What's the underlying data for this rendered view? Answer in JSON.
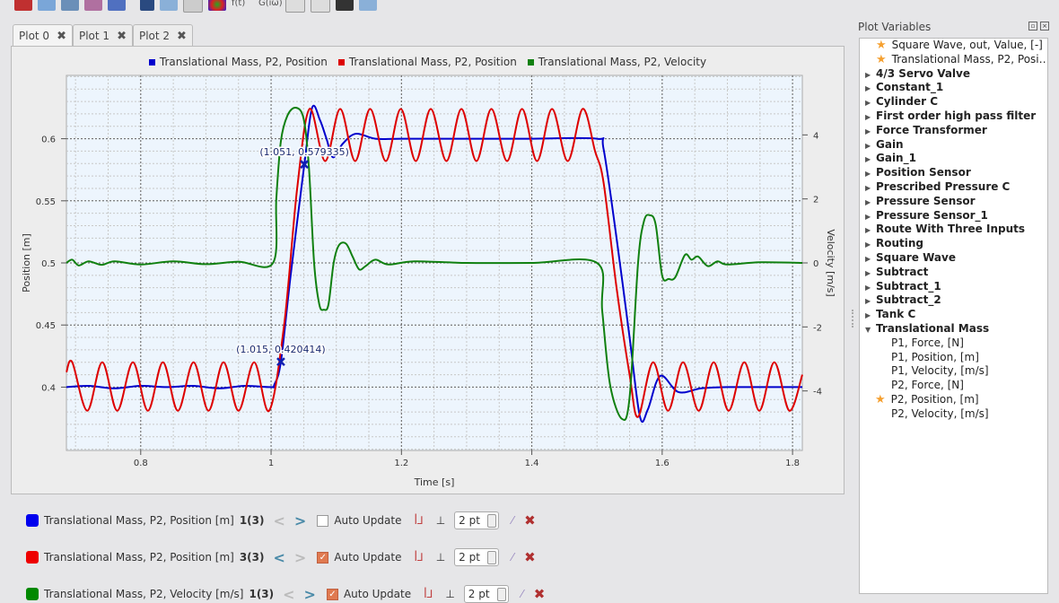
{
  "toolbar": {
    "icons": [
      "new-plot-icon",
      "open-icon",
      "table-icon",
      "fft-plot-icon",
      "export-icon",
      "zoom-icon",
      "pan-icon",
      "grid-icon",
      "colors-icon",
      "bode-icon",
      "legend-icon",
      "arrow-icon"
    ],
    "ft_label": "f(t)",
    "gw_label": "G(iω)"
  },
  "tabs": [
    {
      "label": "Plot 0"
    },
    {
      "label": "Plot 1"
    },
    {
      "label": "Plot 2"
    }
  ],
  "tab_close": "✖",
  "chart_data": {
    "type": "line",
    "xlabel": "Time [s]",
    "ylabel": "Position [m]",
    "y2label": "Velocity [m/s]",
    "xlim": [
      0.686,
      1.815
    ],
    "ylim": [
      0.349,
      0.651
    ],
    "y2lim": [
      -5.86,
      5.86
    ],
    "xticks": [
      0.8,
      1,
      1.2,
      1.4,
      1.6,
      1.8
    ],
    "yticks": [
      0.4,
      0.45,
      0.5,
      0.55,
      0.6
    ],
    "y2ticks": [
      -4,
      -2,
      0,
      2,
      4
    ],
    "grid": true,
    "legend": "top",
    "series": [
      {
        "name": "Translational Mass, P2, Position",
        "color": "#0000cc",
        "axis": "left",
        "points": [
          [
            0.686,
            0.4
          ],
          [
            0.72,
            0.401
          ],
          [
            0.76,
            0.399
          ],
          [
            0.8,
            0.401
          ],
          [
            0.84,
            0.4
          ],
          [
            0.88,
            0.401
          ],
          [
            0.92,
            0.399
          ],
          [
            0.96,
            0.401
          ],
          [
            1.0,
            0.4
          ],
          [
            1.005,
            0.402
          ],
          [
            1.015,
            0.4204
          ],
          [
            1.03,
            0.49
          ],
          [
            1.051,
            0.5793
          ],
          [
            1.063,
            0.625
          ],
          [
            1.075,
            0.615
          ],
          [
            1.085,
            0.6
          ],
          [
            1.095,
            0.585
          ],
          [
            1.11,
            0.596
          ],
          [
            1.13,
            0.604
          ],
          [
            1.16,
            0.6
          ],
          [
            1.2,
            0.6
          ],
          [
            1.3,
            0.6
          ],
          [
            1.4,
            0.6
          ],
          [
            1.5,
            0.6
          ],
          [
            1.51,
            0.592
          ],
          [
            1.53,
            0.52
          ],
          [
            1.55,
            0.44
          ],
          [
            1.566,
            0.376
          ],
          [
            1.578,
            0.382
          ],
          [
            1.597,
            0.409
          ],
          [
            1.625,
            0.396
          ],
          [
            1.66,
            0.399
          ],
          [
            1.7,
            0.4
          ],
          [
            1.75,
            0.4
          ],
          [
            1.815,
            0.4
          ]
        ]
      },
      {
        "name": "Translational Mass, P2, Position",
        "color": "#dd0000",
        "axis": "left",
        "points": [
          [
            0.686,
            0.412
          ],
          [
            0.695,
            0.42
          ],
          [
            0.718,
            0.381
          ],
          [
            0.741,
            0.42
          ],
          [
            0.764,
            0.381
          ],
          [
            0.788,
            0.42
          ],
          [
            0.811,
            0.381
          ],
          [
            0.834,
            0.42
          ],
          [
            0.857,
            0.381
          ],
          [
            0.881,
            0.42
          ],
          [
            0.904,
            0.381
          ],
          [
            0.927,
            0.42
          ],
          [
            0.95,
            0.381
          ],
          [
            0.974,
            0.42
          ],
          [
            0.997,
            0.381
          ],
          [
            1.02,
            0.45
          ],
          [
            1.04,
            0.56
          ],
          [
            1.059,
            0.624
          ],
          [
            1.083,
            0.582
          ],
          [
            1.106,
            0.624
          ],
          [
            1.129,
            0.582
          ],
          [
            1.152,
            0.624
          ],
          [
            1.176,
            0.582
          ],
          [
            1.199,
            0.624
          ],
          [
            1.222,
            0.582
          ],
          [
            1.245,
            0.624
          ],
          [
            1.269,
            0.582
          ],
          [
            1.292,
            0.624
          ],
          [
            1.315,
            0.582
          ],
          [
            1.338,
            0.624
          ],
          [
            1.362,
            0.582
          ],
          [
            1.385,
            0.624
          ],
          [
            1.408,
            0.582
          ],
          [
            1.431,
            0.624
          ],
          [
            1.455,
            0.582
          ],
          [
            1.478,
            0.624
          ],
          [
            1.497,
            0.59
          ],
          [
            1.51,
            0.565
          ],
          [
            1.53,
            0.48
          ],
          [
            1.55,
            0.41
          ],
          [
            1.563,
            0.376
          ],
          [
            1.586,
            0.42
          ],
          [
            1.609,
            0.381
          ],
          [
            1.632,
            0.42
          ],
          [
            1.656,
            0.381
          ],
          [
            1.679,
            0.42
          ],
          [
            1.702,
            0.381
          ],
          [
            1.726,
            0.42
          ],
          [
            1.749,
            0.381
          ],
          [
            1.772,
            0.42
          ],
          [
            1.795,
            0.381
          ],
          [
            1.815,
            0.41
          ]
        ]
      },
      {
        "name": "Translational Mass, P2, Velocity",
        "color": "#108010",
        "axis": "right",
        "points": [
          [
            0.686,
            0
          ],
          [
            0.695,
            0.1
          ],
          [
            0.705,
            -0.08
          ],
          [
            0.72,
            0.05
          ],
          [
            0.74,
            -0.06
          ],
          [
            0.76,
            0.05
          ],
          [
            0.8,
            -0.05
          ],
          [
            0.85,
            0.05
          ],
          [
            0.9,
            -0.04
          ],
          [
            0.95,
            0.04
          ],
          [
            1.003,
            0
          ],
          [
            1.008,
            2
          ],
          [
            1.015,
            3.8
          ],
          [
            1.025,
            4.6
          ],
          [
            1.038,
            4.85
          ],
          [
            1.05,
            4.5
          ],
          [
            1.058,
            3
          ],
          [
            1.066,
            0
          ],
          [
            1.074,
            -1.3
          ],
          [
            1.081,
            -1.46
          ],
          [
            1.088,
            -1.3
          ],
          [
            1.096,
            0
          ],
          [
            1.104,
            0.55
          ],
          [
            1.115,
            0.6
          ],
          [
            1.125,
            0.2
          ],
          [
            1.135,
            -0.2
          ],
          [
            1.145,
            -0.1
          ],
          [
            1.16,
            0.1
          ],
          [
            1.18,
            -0.05
          ],
          [
            1.22,
            0.05
          ],
          [
            1.3,
            0
          ],
          [
            1.4,
            0
          ],
          [
            1.5,
            0
          ],
          [
            1.508,
            -1.5
          ],
          [
            1.52,
            -3.8
          ],
          [
            1.538,
            -4.87
          ],
          [
            1.55,
            -4.2
          ],
          [
            1.563,
            0
          ],
          [
            1.572,
            1.3
          ],
          [
            1.581,
            1.49
          ],
          [
            1.59,
            1.2
          ],
          [
            1.6,
            -0.4
          ],
          [
            1.61,
            -0.5
          ],
          [
            1.62,
            -0.45
          ],
          [
            1.635,
            0.25
          ],
          [
            1.645,
            0.1
          ],
          [
            1.655,
            0.2
          ],
          [
            1.67,
            -0.1
          ],
          [
            1.685,
            0.05
          ],
          [
            1.7,
            -0.05
          ],
          [
            1.75,
            0.02
          ],
          [
            1.815,
            0
          ]
        ]
      }
    ],
    "markers": [
      {
        "x": 1.015,
        "y": 0.420414,
        "label": "(1.015, 0.420414)"
      },
      {
        "x": 1.051,
        "y": 0.579335,
        "label": "(1.051, 0.579335)"
      }
    ]
  },
  "curves": [
    {
      "label": "Translational Mass, P2, Position [m]",
      "count": "1(3)",
      "color": "#0000ee",
      "auto_update": false,
      "prev_enabled": false,
      "next_enabled": true,
      "width": "2 pt"
    },
    {
      "label": "Translational Mass, P2, Position [m]",
      "count": "3(3)",
      "color": "#ee0000",
      "auto_update": true,
      "prev_enabled": true,
      "next_enabled": false,
      "width": "2 pt"
    },
    {
      "label": "Translational Mass, P2, Velocity [m/s]",
      "count": "1(3)",
      "color": "#008800",
      "auto_update": true,
      "prev_enabled": false,
      "next_enabled": true,
      "width": "2 pt"
    }
  ],
  "curve_auto_update_label": "Auto Update",
  "dock": {
    "title": "Plot Variables",
    "favorites": [
      "Square Wave, out, Value, [-]",
      "Translational Mass, P2, Posi…"
    ],
    "items": [
      "4/3 Servo Valve",
      "Constant_1",
      "Cylinder C",
      "First order high pass filter",
      "Force Transformer",
      "Gain",
      "Gain_1",
      "Position Sensor",
      "Prescribed Pressure C",
      "Pressure Sensor",
      "Pressure Sensor_1",
      "Route With Three Inputs",
      "Routing",
      "Square Wave",
      "Subtract",
      "Subtract_1",
      "Subtract_2",
      "Tank C"
    ],
    "expanded": {
      "label": "Translational Mass",
      "children": [
        {
          "label": "P1, Force, [N]",
          "plotted": false
        },
        {
          "label": "P1, Position, [m]",
          "plotted": false
        },
        {
          "label": "P1, Velocity, [m/s]",
          "plotted": false
        },
        {
          "label": "P2, Force, [N]",
          "plotted": false
        },
        {
          "label": "P2, Position, [m]",
          "plotted": true
        },
        {
          "label": "P2, Velocity, [m/s]",
          "plotted": false
        }
      ]
    }
  }
}
